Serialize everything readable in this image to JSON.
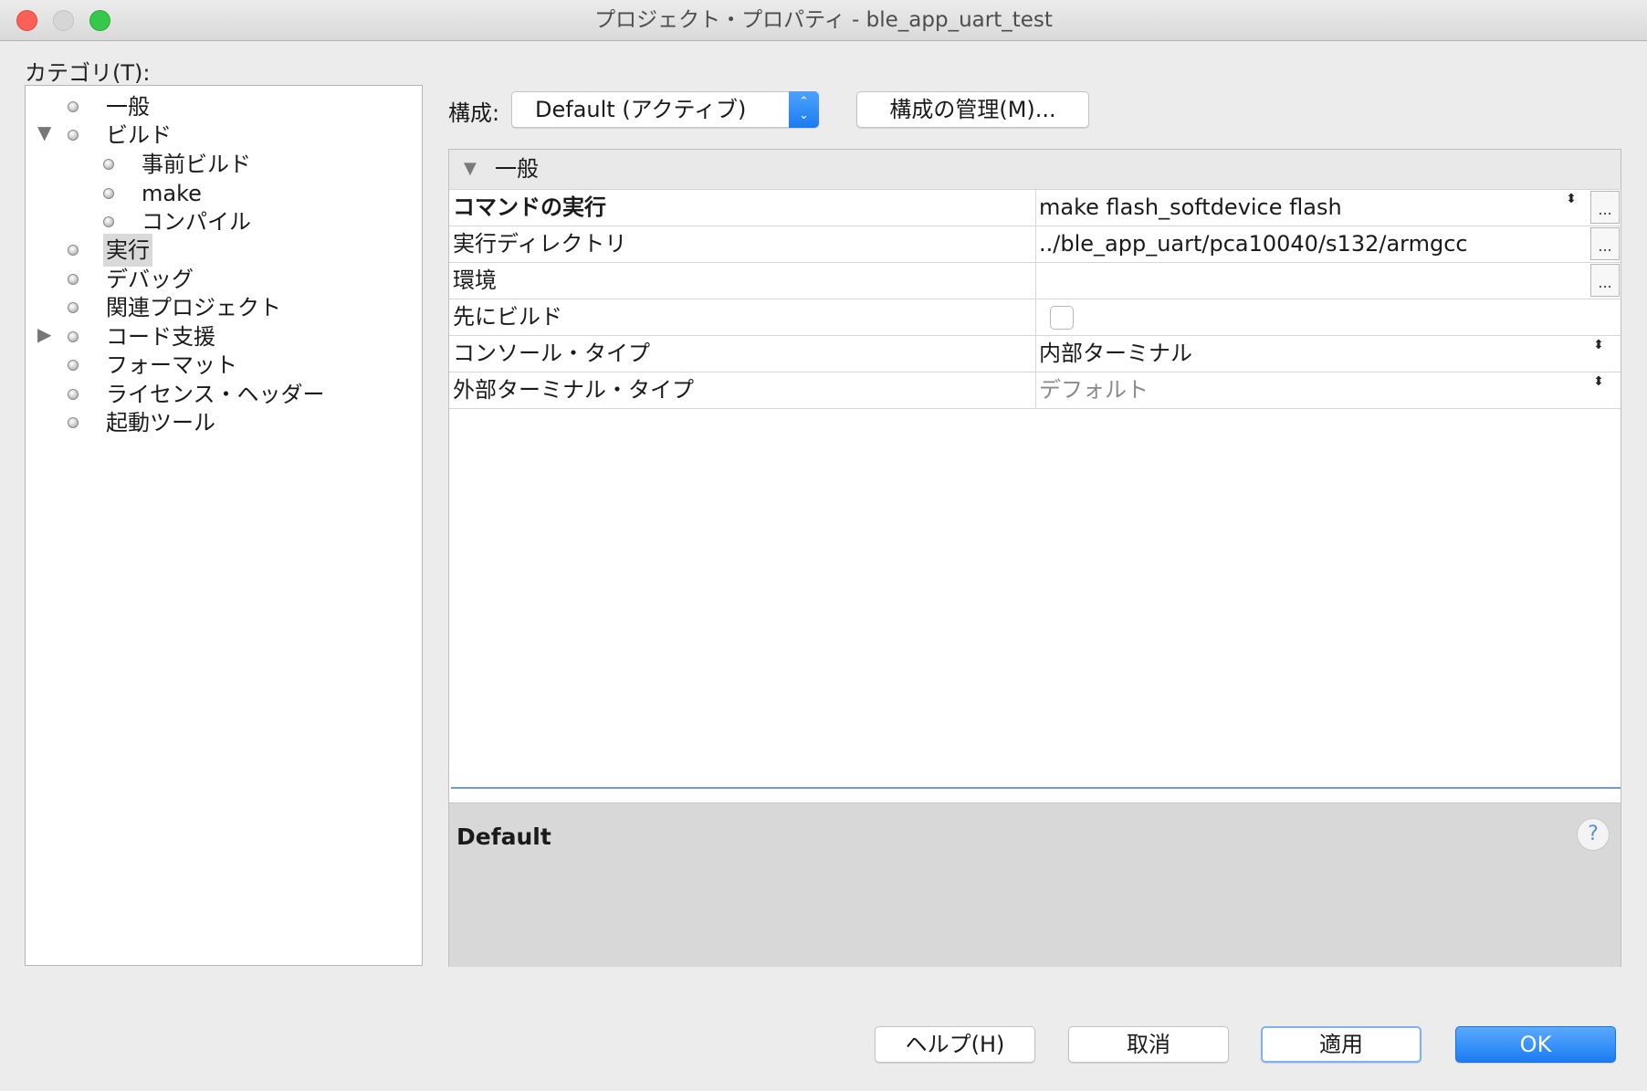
{
  "window": {
    "title": "プロジェクト・プロパティ - ble_app_uart_test"
  },
  "categories": {
    "label": "カテゴリ(T):",
    "items": [
      {
        "label": "一般"
      },
      {
        "label": "ビルド",
        "toggle": "▼"
      },
      {
        "label": "事前ビルド"
      },
      {
        "label": "make"
      },
      {
        "label": "コンパイル"
      },
      {
        "label": "実行",
        "selected": true
      },
      {
        "label": "デバッグ"
      },
      {
        "label": "関連プロジェクト"
      },
      {
        "label": "コード支援",
        "toggle": "▶"
      },
      {
        "label": "フォーマット"
      },
      {
        "label": "ライセンス・ヘッダー"
      },
      {
        "label": "起動ツール"
      }
    ]
  },
  "config": {
    "label": "構成:",
    "selected": "Default (アクティブ)",
    "stepper": {
      "up": "⌃",
      "down": "⌄"
    },
    "manage_button": "構成の管理(M)..."
  },
  "properties": {
    "section": {
      "toggle": "▼",
      "title": "一般"
    },
    "rows": [
      {
        "name": "コマンドの実行",
        "value": "make flash_softdevice flash",
        "updown": "⬍",
        "ellipsis": "..."
      },
      {
        "name": "実行ディレクトリ",
        "value": "../ble_app_uart/pca10040/s132/armgcc",
        "ellipsis": "..."
      },
      {
        "name": "環境",
        "value": "",
        "ellipsis": "..."
      },
      {
        "name": "先にビルド",
        "checked": false
      },
      {
        "name": "コンソール・タイプ",
        "value": "内部ターミナル",
        "updown": "⬍"
      },
      {
        "name": "外部ターミナル・タイプ",
        "value": "デフォルト",
        "updown": "⬍"
      }
    ]
  },
  "description": {
    "title": "Default",
    "help_icon": "?"
  },
  "buttons": {
    "help": "ヘルプ(H)",
    "cancel": "取消",
    "apply": "適用",
    "ok": "OK"
  }
}
